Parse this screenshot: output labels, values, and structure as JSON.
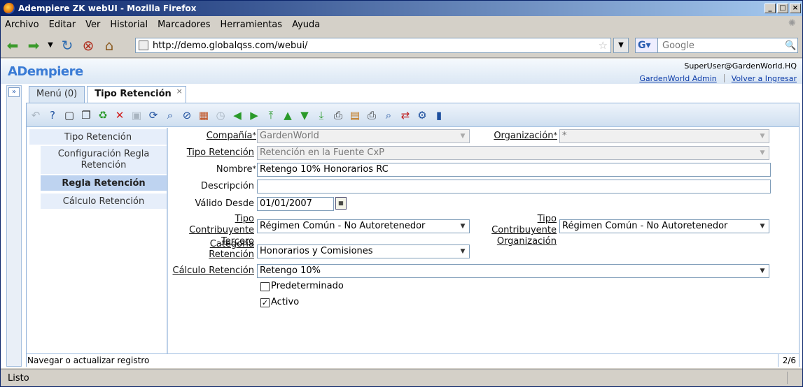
{
  "window": {
    "title": "Adempiere ZK webUI - Mozilla Firefox"
  },
  "menubar": [
    "Archivo",
    "Editar",
    "Ver",
    "Historial",
    "Marcadores",
    "Herramientas",
    "Ayuda"
  ],
  "navbar": {
    "url": "http://demo.globalqss.com/webui/",
    "search_placeholder": "Google"
  },
  "app": {
    "logo": "ADempiere",
    "user": "SuperUser@GardenWorld.HQ",
    "role_link": "GardenWorld Admin",
    "relogin_link": "Volver a Ingresar",
    "tabs": [
      {
        "label": "Menú (0)"
      },
      {
        "label": "Tipo Retención",
        "close": "×"
      }
    ],
    "sidebar": [
      {
        "label": "Tipo Retención"
      },
      {
        "label": "Configuración Regla Retención"
      },
      {
        "label": "Regla Retención"
      },
      {
        "label": "Cálculo Retención"
      }
    ],
    "form": {
      "compania": {
        "label": "Compañía",
        "req": "*",
        "value": "GardenWorld"
      },
      "organizacion": {
        "label": "Organización",
        "req": "*",
        "value": "*"
      },
      "tipo_retencion": {
        "label": "Tipo Retención",
        "value": "Retención en la Fuente CxP"
      },
      "nombre": {
        "label": "Nombre",
        "req": "*",
        "value": "Retengo 10% Honorarios RC"
      },
      "descripcion": {
        "label": "Descripción",
        "value": ""
      },
      "valido_desde": {
        "label": "Válido Desde",
        "value": "01/01/2007"
      },
      "tipo_contrib_tercero": {
        "label1": "Tipo Contribuyente",
        "label2": "Tercero",
        "value": "Régimen Común - No Autoretenedor"
      },
      "tipo_contrib_org": {
        "label1": "Tipo Contribuyente",
        "label2": "Organización",
        "value": "Régimen Común - No Autoretenedor"
      },
      "categoria_retencion": {
        "label1": "Categoría",
        "label2": "Retención",
        "value": "Honorarios y Comisiones"
      },
      "calculo_retencion": {
        "label": "Cálculo Retención",
        "value": "Retengo 10%"
      },
      "predeterminado": {
        "label": "Predeterminado",
        "checked": false
      },
      "activo": {
        "label": "Activo",
        "checked": true,
        "mark": "✓"
      }
    },
    "status": {
      "message": "Navegar o actualizar registro",
      "record": "2/6"
    }
  },
  "firefox_status": "Listo"
}
